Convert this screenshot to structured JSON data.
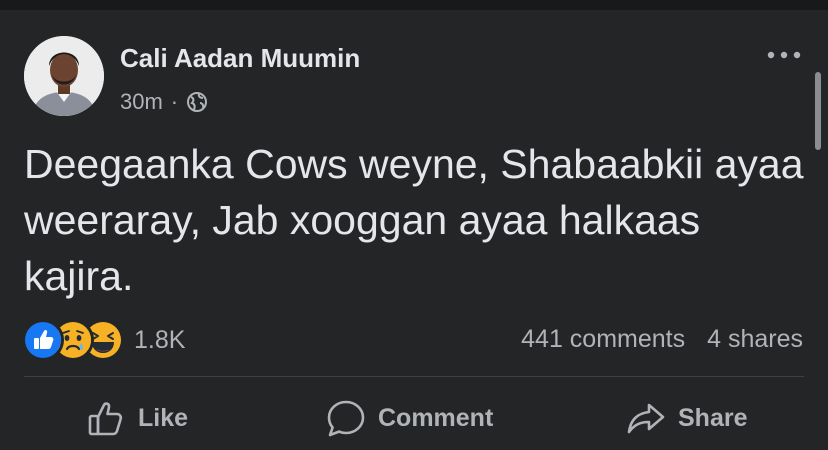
{
  "post": {
    "author": "Cali Aadan Muumin",
    "time": "30m",
    "separator": "·",
    "privacy_icon": "globe-icon",
    "more_icon": "more-icon",
    "text": "Deegaanka Cows weyne, Shabaabkii ayaa weeraray, Jab xooggan ayaa halkaas kajira.",
    "reactions": {
      "icons": [
        "like-reaction-icon",
        "sad-reaction-icon",
        "haha-reaction-icon"
      ],
      "count": "1.8K"
    },
    "comments_count": "441 comments",
    "shares_count": "4 shares"
  },
  "actions": {
    "like_label": "Like",
    "comment_label": "Comment",
    "share_label": "Share"
  },
  "colors": {
    "background": "#242526",
    "text_primary": "#e4e6eb",
    "text_secondary": "#b0b3b8",
    "like_blue": "#1877f2",
    "reaction_yellow": "#f7b125"
  }
}
